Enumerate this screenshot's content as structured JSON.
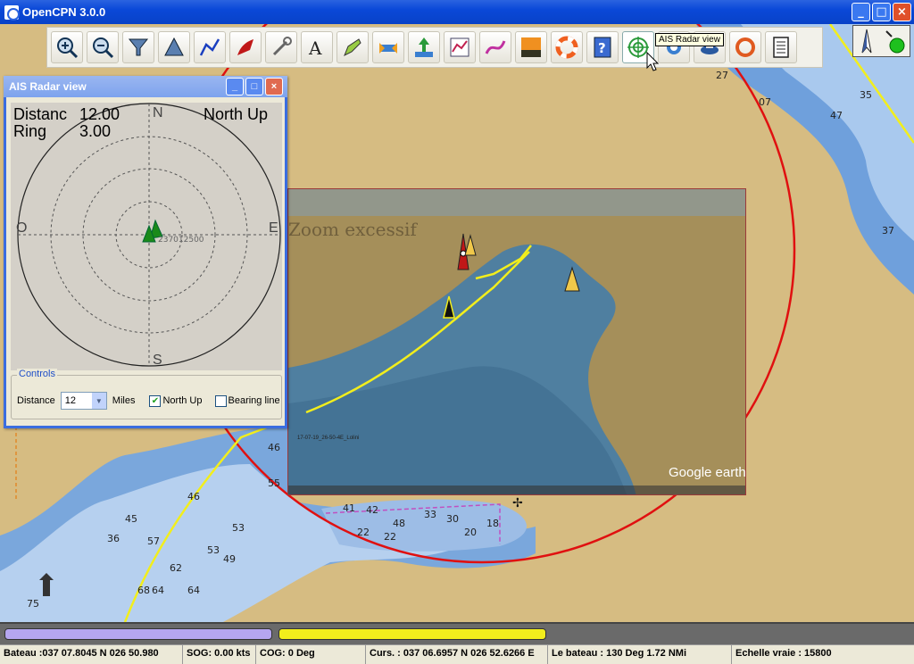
{
  "app": {
    "title": "OpenCPN 3.0.0"
  },
  "window_buttons": {
    "minimize": "_",
    "maximize": "□",
    "close": "×"
  },
  "toolbar": {
    "buttons": [
      "zoom-in",
      "zoom-out",
      "scale-in",
      "scale-out",
      "route",
      "track",
      "settings",
      "text",
      "route-manager",
      "ais",
      "tide",
      "current",
      "chart-quilt",
      "track-record",
      "night-mode",
      "man-overboard",
      "help",
      "ais-radar",
      "ais-target-list",
      "gpx",
      "print"
    ],
    "tooltip": "AIS Radar view"
  },
  "ais_radar": {
    "title": "AIS Radar view",
    "distance_label": "Distanc",
    "distance_value": "12.00",
    "ring_label": "Ring",
    "ring_value": "3.00",
    "orientation": "North Up",
    "compass": {
      "n": "N",
      "s": "S",
      "e": "E",
      "w": "O"
    },
    "target_label": "237012500",
    "controls": {
      "legend": "Controls",
      "distance_label": "Distance",
      "distance_value": "12",
      "units": "Miles",
      "north_up_label": "North Up",
      "north_up_checked": true,
      "bearing_line_label": "Bearing line",
      "bearing_line_checked": false
    }
  },
  "overlay": {
    "zoom_text": "Zoom excessif",
    "watermark": "Google earth",
    "track_name": "17-07-19_26-50-4E_Lolini"
  },
  "chart_soundings": [
    "27",
    "07",
    "35",
    "47",
    "37",
    "53",
    "46",
    "49",
    "64",
    "57",
    "62",
    "53",
    "45",
    "36",
    "41",
    "46",
    "55",
    "68",
    "64",
    "75",
    "42",
    "48",
    "33",
    "30",
    "22",
    "22",
    "20",
    "18"
  ],
  "progress": {
    "color_1": "#b5a6f0",
    "color_2": "#f2ee1c"
  },
  "status": {
    "position": "Bateau :037 07.8045 N   026 50.980",
    "sog": "SOG: 0.00 kts",
    "cog": "COG:   0 Deg",
    "cursor": "Curs. : 037 06.6957 N 026 52.6266 E",
    "bearing": "Le bateau : 130 Deg    1.72 NMi",
    "scale": "Echelle vraie :     15800"
  }
}
